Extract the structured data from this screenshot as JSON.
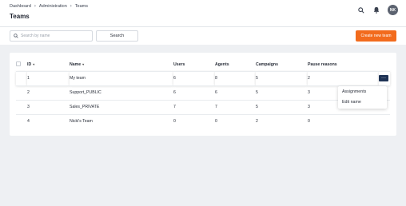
{
  "breadcrumb": [
    "Dashboard",
    "Administration",
    "Teams"
  ],
  "page": {
    "title": "Teams"
  },
  "user": {
    "initials": "NK"
  },
  "search": {
    "placeholder": "Search by name",
    "button_label": "Search"
  },
  "actions": {
    "create_label": "Create new team"
  },
  "table": {
    "columns": [
      "ID",
      "Name",
      "Users",
      "Agents",
      "Campaigns",
      "Pause reasons"
    ],
    "sort_indicator": "▾",
    "rows": [
      {
        "id": "1",
        "name": "My team",
        "users": "6",
        "agents": "8",
        "campaigns": "5",
        "pause_reasons": "2"
      },
      {
        "id": "2",
        "name": "Support_PUBLIC",
        "users": "6",
        "agents": "6",
        "campaigns": "5",
        "pause_reasons": "3"
      },
      {
        "id": "3",
        "name": "Sales_PRIVATE",
        "users": "7",
        "agents": "7",
        "campaigns": "5",
        "pause_reasons": "3"
      },
      {
        "id": "4",
        "name": "Nicki's Team",
        "users": "0",
        "agents": "0",
        "campaigns": "2",
        "pause_reasons": "0"
      }
    ]
  },
  "row_menu": {
    "more_label": "···",
    "items": [
      "Assignments",
      "Edit name"
    ]
  },
  "colors": {
    "accent": "#f26b1d",
    "more_button": "#1f3355",
    "avatar": "#5c6370"
  }
}
